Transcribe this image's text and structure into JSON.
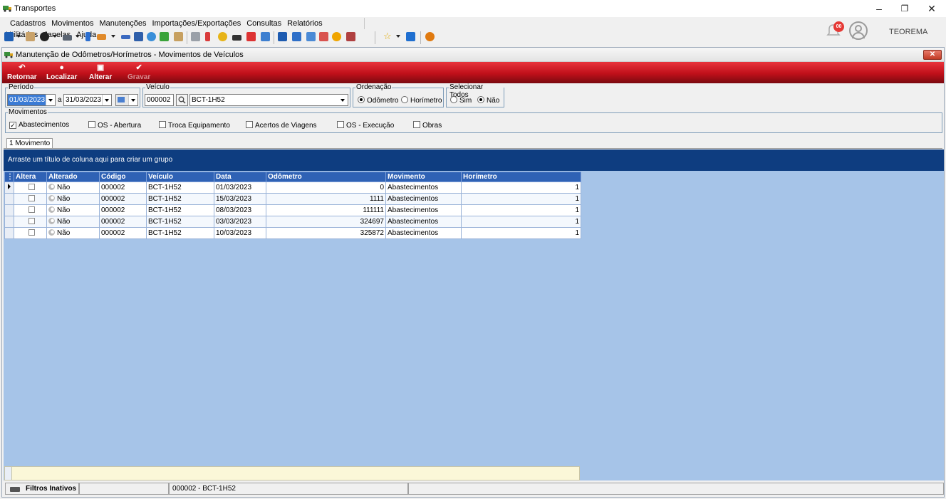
{
  "app": {
    "title": "Transportes",
    "company": "TEOREMA",
    "notifications": "00"
  },
  "menu": [
    "Cadastros",
    "Movimentos",
    "Manutenções",
    "Importações/Exportações",
    "Consultas",
    "Relatórios",
    "Utilitários",
    "Janelas",
    "Ajuda"
  ],
  "window": {
    "title": "Manutenção de Odômetros/Horímetros - Movimentos de Veículos",
    "close": "✕"
  },
  "actions": {
    "retornar": "Retornar",
    "localizar": "Localizar",
    "alterar": "Alterar",
    "gravar": "Gravar"
  },
  "filters": {
    "periodo_label": "Período",
    "date_from": "01/03/2023",
    "date_sep": "a",
    "date_to": "31/03/2023",
    "veiculo_label": "Veículo",
    "veiculo_code": "000002",
    "veiculo_name": "BCT-1H52",
    "ordenacao_label": "Ordenação",
    "ord_odometro": "Odômetro",
    "ord_horimetro": "Horímetro",
    "selecionar_label": "Selecionar Todos",
    "sel_sim": "Sim",
    "sel_nao": "Não"
  },
  "movimentos": {
    "label": "Movimentos",
    "items": [
      {
        "label": "Abastecimentos",
        "checked": true
      },
      {
        "label": "OS - Abertura",
        "checked": false
      },
      {
        "label": "Troca Equipamento",
        "checked": false
      },
      {
        "label": "Acertos de Viagens",
        "checked": false
      },
      {
        "label": "OS - Execução",
        "checked": false
      },
      {
        "label": "Obras",
        "checked": false
      }
    ]
  },
  "tab": "1 Movimento",
  "grid": {
    "group_hint": "Arraste um título de coluna aqui para criar um grupo",
    "columns": [
      "Altera",
      "Alterado",
      "Código",
      "Veículo",
      "Data",
      "Odômetro",
      "Movimento",
      "Horímetro"
    ],
    "rows": [
      {
        "alterado": "Não",
        "codigo": "000002",
        "veiculo": "BCT-1H52",
        "data": "01/03/2023",
        "odometro": "0",
        "movimento": "Abastecimentos",
        "horimetro": "1"
      },
      {
        "alterado": "Não",
        "codigo": "000002",
        "veiculo": "BCT-1H52",
        "data": "15/03/2023",
        "odometro": "1111",
        "movimento": "Abastecimentos",
        "horimetro": "1"
      },
      {
        "alterado": "Não",
        "codigo": "000002",
        "veiculo": "BCT-1H52",
        "data": "08/03/2023",
        "odometro": "111111",
        "movimento": "Abastecimentos",
        "horimetro": "1"
      },
      {
        "alterado": "Não",
        "codigo": "000002",
        "veiculo": "BCT-1H52",
        "data": "03/03/2023",
        "odometro": "324697",
        "movimento": "Abastecimentos",
        "horimetro": "1"
      },
      {
        "alterado": "Não",
        "codigo": "000002",
        "veiculo": "BCT-1H52",
        "data": "10/03/2023",
        "odometro": "325872",
        "movimento": "Abastecimentos",
        "horimetro": "1"
      }
    ]
  },
  "status": {
    "filters": "Filtros Inativos",
    "vehicle": "000002 - BCT-1H52"
  }
}
